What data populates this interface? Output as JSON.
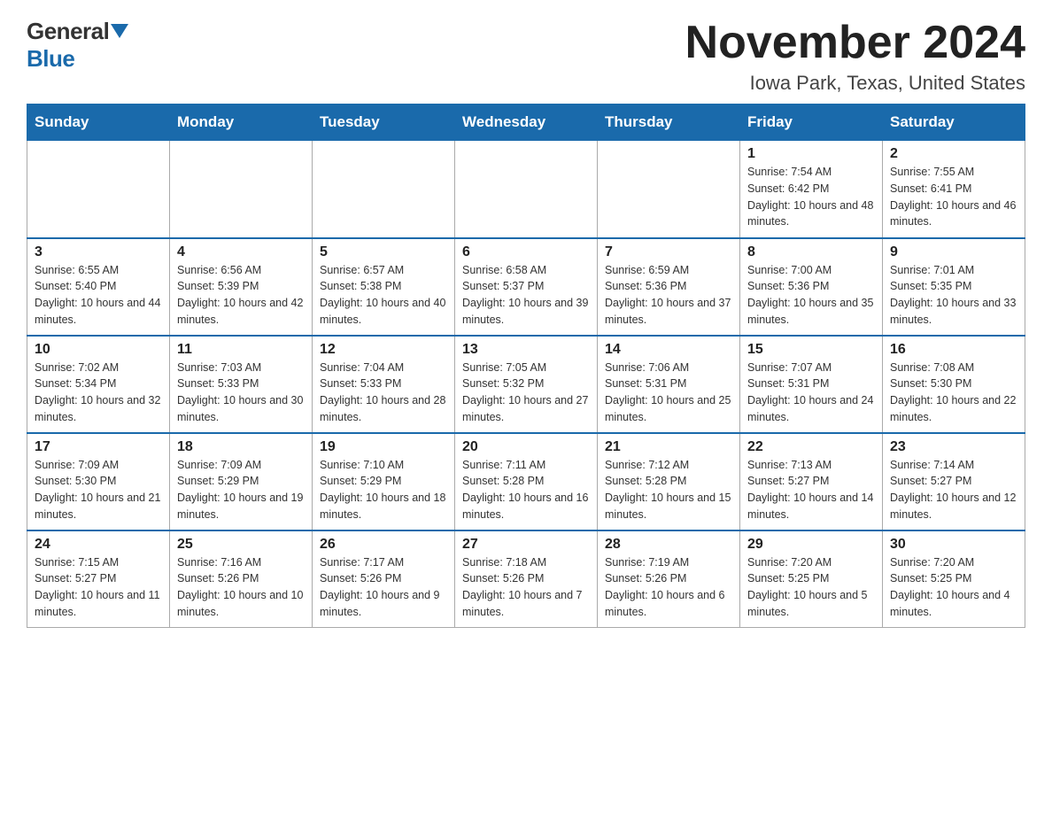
{
  "header": {
    "logo_general": "General",
    "logo_blue": "Blue",
    "month_title": "November 2024",
    "location": "Iowa Park, Texas, United States"
  },
  "weekdays": [
    "Sunday",
    "Monday",
    "Tuesday",
    "Wednesday",
    "Thursday",
    "Friday",
    "Saturday"
  ],
  "weeks": [
    [
      {
        "day": "",
        "info": ""
      },
      {
        "day": "",
        "info": ""
      },
      {
        "day": "",
        "info": ""
      },
      {
        "day": "",
        "info": ""
      },
      {
        "day": "",
        "info": ""
      },
      {
        "day": "1",
        "info": "Sunrise: 7:54 AM\nSunset: 6:42 PM\nDaylight: 10 hours and 48 minutes."
      },
      {
        "day": "2",
        "info": "Sunrise: 7:55 AM\nSunset: 6:41 PM\nDaylight: 10 hours and 46 minutes."
      }
    ],
    [
      {
        "day": "3",
        "info": "Sunrise: 6:55 AM\nSunset: 5:40 PM\nDaylight: 10 hours and 44 minutes."
      },
      {
        "day": "4",
        "info": "Sunrise: 6:56 AM\nSunset: 5:39 PM\nDaylight: 10 hours and 42 minutes."
      },
      {
        "day": "5",
        "info": "Sunrise: 6:57 AM\nSunset: 5:38 PM\nDaylight: 10 hours and 40 minutes."
      },
      {
        "day": "6",
        "info": "Sunrise: 6:58 AM\nSunset: 5:37 PM\nDaylight: 10 hours and 39 minutes."
      },
      {
        "day": "7",
        "info": "Sunrise: 6:59 AM\nSunset: 5:36 PM\nDaylight: 10 hours and 37 minutes."
      },
      {
        "day": "8",
        "info": "Sunrise: 7:00 AM\nSunset: 5:36 PM\nDaylight: 10 hours and 35 minutes."
      },
      {
        "day": "9",
        "info": "Sunrise: 7:01 AM\nSunset: 5:35 PM\nDaylight: 10 hours and 33 minutes."
      }
    ],
    [
      {
        "day": "10",
        "info": "Sunrise: 7:02 AM\nSunset: 5:34 PM\nDaylight: 10 hours and 32 minutes."
      },
      {
        "day": "11",
        "info": "Sunrise: 7:03 AM\nSunset: 5:33 PM\nDaylight: 10 hours and 30 minutes."
      },
      {
        "day": "12",
        "info": "Sunrise: 7:04 AM\nSunset: 5:33 PM\nDaylight: 10 hours and 28 minutes."
      },
      {
        "day": "13",
        "info": "Sunrise: 7:05 AM\nSunset: 5:32 PM\nDaylight: 10 hours and 27 minutes."
      },
      {
        "day": "14",
        "info": "Sunrise: 7:06 AM\nSunset: 5:31 PM\nDaylight: 10 hours and 25 minutes."
      },
      {
        "day": "15",
        "info": "Sunrise: 7:07 AM\nSunset: 5:31 PM\nDaylight: 10 hours and 24 minutes."
      },
      {
        "day": "16",
        "info": "Sunrise: 7:08 AM\nSunset: 5:30 PM\nDaylight: 10 hours and 22 minutes."
      }
    ],
    [
      {
        "day": "17",
        "info": "Sunrise: 7:09 AM\nSunset: 5:30 PM\nDaylight: 10 hours and 21 minutes."
      },
      {
        "day": "18",
        "info": "Sunrise: 7:09 AM\nSunset: 5:29 PM\nDaylight: 10 hours and 19 minutes."
      },
      {
        "day": "19",
        "info": "Sunrise: 7:10 AM\nSunset: 5:29 PM\nDaylight: 10 hours and 18 minutes."
      },
      {
        "day": "20",
        "info": "Sunrise: 7:11 AM\nSunset: 5:28 PM\nDaylight: 10 hours and 16 minutes."
      },
      {
        "day": "21",
        "info": "Sunrise: 7:12 AM\nSunset: 5:28 PM\nDaylight: 10 hours and 15 minutes."
      },
      {
        "day": "22",
        "info": "Sunrise: 7:13 AM\nSunset: 5:27 PM\nDaylight: 10 hours and 14 minutes."
      },
      {
        "day": "23",
        "info": "Sunrise: 7:14 AM\nSunset: 5:27 PM\nDaylight: 10 hours and 12 minutes."
      }
    ],
    [
      {
        "day": "24",
        "info": "Sunrise: 7:15 AM\nSunset: 5:27 PM\nDaylight: 10 hours and 11 minutes."
      },
      {
        "day": "25",
        "info": "Sunrise: 7:16 AM\nSunset: 5:26 PM\nDaylight: 10 hours and 10 minutes."
      },
      {
        "day": "26",
        "info": "Sunrise: 7:17 AM\nSunset: 5:26 PM\nDaylight: 10 hours and 9 minutes."
      },
      {
        "day": "27",
        "info": "Sunrise: 7:18 AM\nSunset: 5:26 PM\nDaylight: 10 hours and 7 minutes."
      },
      {
        "day": "28",
        "info": "Sunrise: 7:19 AM\nSunset: 5:26 PM\nDaylight: 10 hours and 6 minutes."
      },
      {
        "day": "29",
        "info": "Sunrise: 7:20 AM\nSunset: 5:25 PM\nDaylight: 10 hours and 5 minutes."
      },
      {
        "day": "30",
        "info": "Sunrise: 7:20 AM\nSunset: 5:25 PM\nDaylight: 10 hours and 4 minutes."
      }
    ]
  ]
}
